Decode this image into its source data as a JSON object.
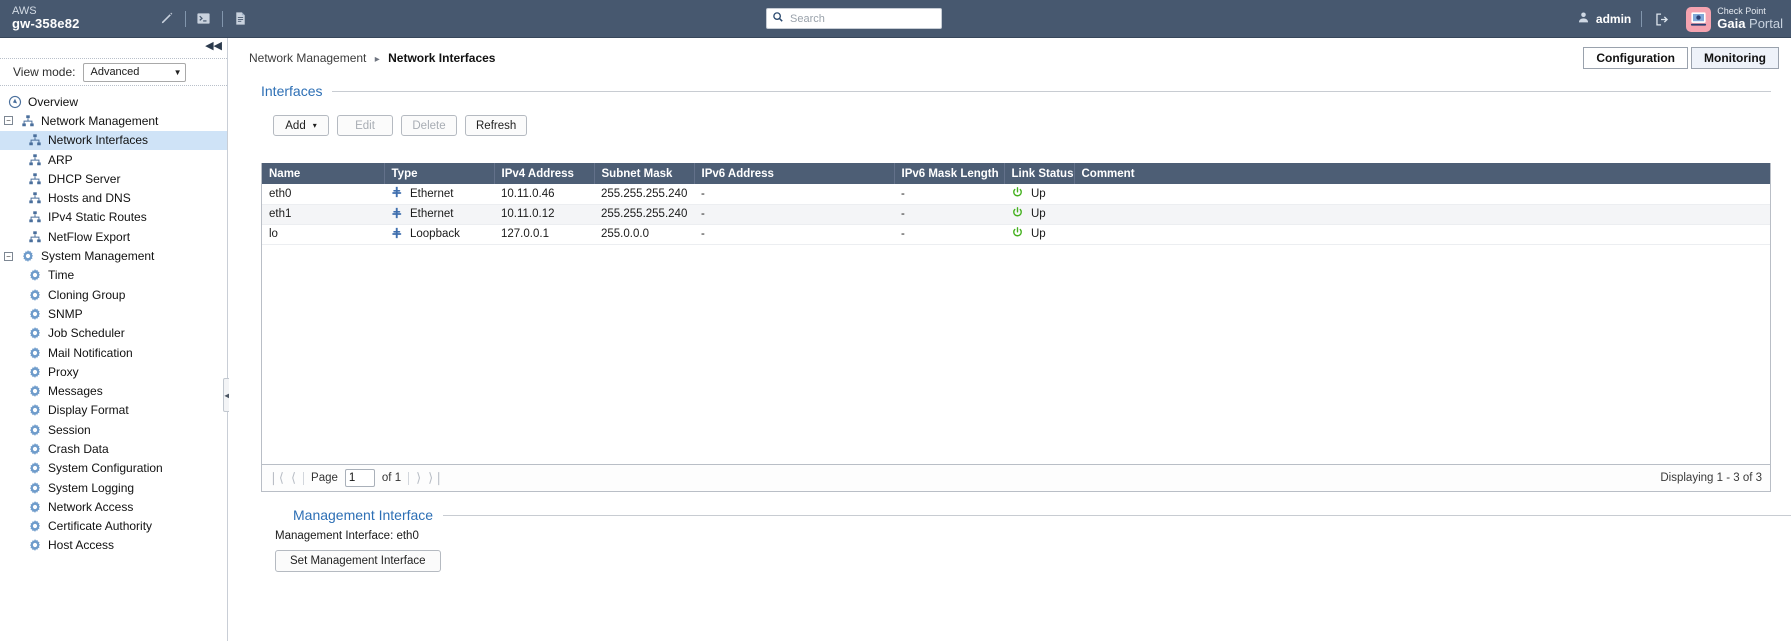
{
  "topbar": {
    "brand_sub": "AWS",
    "brand_host": "gw-358e82",
    "tools": [
      {
        "icon": "pencil-icon",
        "name": "edit-tool"
      },
      {
        "icon": "terminal-icon",
        "name": "terminal-tool"
      },
      {
        "icon": "document-icon",
        "name": "document-tool"
      }
    ],
    "search": {
      "value": "",
      "placeholder": "Search",
      "icon": "search-icon"
    },
    "user": {
      "label": "admin",
      "icon": "user-icon"
    },
    "logout_icon": "logout-icon",
    "logo": {
      "line1": "Check Point",
      "line2_bold": "Gaia",
      "line2_rest": " Portal",
      "icon": "checkpoint-logo-icon"
    }
  },
  "sidebar": {
    "collapse_label": "◀◀",
    "view_mode_label": "View mode:",
    "view_mode_value": "Advanced",
    "items": [
      {
        "label": "Overview",
        "icon": "overview-icon",
        "level": "top",
        "toggle": null,
        "selected": false
      },
      {
        "label": "Network Management",
        "icon": "network-icon",
        "level": "group",
        "toggle": "−",
        "selected": false
      },
      {
        "label": "Network Interfaces",
        "icon": "network-icon",
        "level": "child",
        "toggle": null,
        "selected": true
      },
      {
        "label": "ARP",
        "icon": "network-icon",
        "level": "child",
        "toggle": null,
        "selected": false
      },
      {
        "label": "DHCP Server",
        "icon": "network-icon",
        "level": "child",
        "toggle": null,
        "selected": false
      },
      {
        "label": "Hosts and DNS",
        "icon": "network-icon",
        "level": "child",
        "toggle": null,
        "selected": false
      },
      {
        "label": "IPv4 Static Routes",
        "icon": "network-icon",
        "level": "child",
        "toggle": null,
        "selected": false
      },
      {
        "label": "NetFlow Export",
        "icon": "network-icon",
        "level": "child",
        "toggle": null,
        "selected": false
      },
      {
        "label": "System Management",
        "icon": "gear-icon",
        "level": "group",
        "toggle": "−",
        "selected": false
      },
      {
        "label": "Time",
        "icon": "gear-icon",
        "level": "child",
        "toggle": null,
        "selected": false
      },
      {
        "label": "Cloning Group",
        "icon": "gear-icon",
        "level": "child",
        "toggle": null,
        "selected": false
      },
      {
        "label": "SNMP",
        "icon": "gear-icon",
        "level": "child",
        "toggle": null,
        "selected": false
      },
      {
        "label": "Job Scheduler",
        "icon": "gear-icon",
        "level": "child",
        "toggle": null,
        "selected": false
      },
      {
        "label": "Mail Notification",
        "icon": "gear-icon",
        "level": "child",
        "toggle": null,
        "selected": false
      },
      {
        "label": "Proxy",
        "icon": "gear-icon",
        "level": "child",
        "toggle": null,
        "selected": false
      },
      {
        "label": "Messages",
        "icon": "gear-icon",
        "level": "child",
        "toggle": null,
        "selected": false
      },
      {
        "label": "Display Format",
        "icon": "gear-icon",
        "level": "child",
        "toggle": null,
        "selected": false
      },
      {
        "label": "Session",
        "icon": "gear-icon",
        "level": "child",
        "toggle": null,
        "selected": false
      },
      {
        "label": "Crash Data",
        "icon": "gear-icon",
        "level": "child",
        "toggle": null,
        "selected": false
      },
      {
        "label": "System Configuration",
        "icon": "gear-icon",
        "level": "child",
        "toggle": null,
        "selected": false
      },
      {
        "label": "System Logging",
        "icon": "gear-icon",
        "level": "child",
        "toggle": null,
        "selected": false
      },
      {
        "label": "Network Access",
        "icon": "gear-icon",
        "level": "child",
        "toggle": null,
        "selected": false
      },
      {
        "label": "Certificate Authority",
        "icon": "gear-icon",
        "level": "child",
        "toggle": null,
        "selected": false
      },
      {
        "label": "Host Access",
        "icon": "gear-icon",
        "level": "child",
        "toggle": null,
        "selected": false
      }
    ]
  },
  "main": {
    "breadcrumb": {
      "parent": "Network Management",
      "separator": "▸",
      "current": "Network Interfaces"
    },
    "mode_buttons": [
      {
        "label": "Configuration",
        "active": true
      },
      {
        "label": "Monitoring",
        "active": false
      }
    ],
    "interfaces_section": {
      "title": "Interfaces",
      "toolbar": [
        {
          "label": "Add",
          "disabled": false,
          "caret": "▾"
        },
        {
          "label": "Edit",
          "disabled": true,
          "caret": null
        },
        {
          "label": "Delete",
          "disabled": true,
          "caret": null
        },
        {
          "label": "Refresh",
          "disabled": false,
          "caret": null
        }
      ],
      "columns": [
        "Name",
        "Type",
        "IPv4 Address",
        "Subnet Mask",
        "IPv6 Address",
        "IPv6 Mask Length",
        "Link Status",
        "Comment"
      ],
      "rows": [
        {
          "name": "eth0",
          "type": "Ethernet",
          "ipv4": "10.11.0.46",
          "mask": "255.255.255.240",
          "ipv6": "-",
          "ipv6len": "-",
          "link": "Up",
          "comment": ""
        },
        {
          "name": "eth1",
          "type": "Ethernet",
          "ipv4": "10.11.0.12",
          "mask": "255.255.255.240",
          "ipv6": "-",
          "ipv6len": "-",
          "link": "Up",
          "comment": ""
        },
        {
          "name": "lo",
          "type": "Loopback",
          "ipv4": "127.0.0.1",
          "mask": "255.0.0.0",
          "ipv6": "-",
          "ipv6len": "-",
          "link": "Up",
          "comment": ""
        }
      ],
      "pager": {
        "first_icon": "❘⟨",
        "prev_icon": "⟨",
        "page_label": "Page",
        "page_value": "1",
        "of_label": "of 1",
        "next_icon": "⟩",
        "last_icon": "⟩❘",
        "displaying": "Displaying 1 - 3 of 3"
      }
    },
    "management_section": {
      "title": "Management Interface",
      "info": "Management Interface: eth0",
      "button": "Set Management Interface"
    }
  },
  "colors": {
    "topbar_bg": "#47586f",
    "table_header_bg": "#4d5e75",
    "selected_nav": "#cfe3f7",
    "section_title": "#2d6fb5",
    "link_up": "#44b11e",
    "logo_pink": "#f5a3b0"
  }
}
